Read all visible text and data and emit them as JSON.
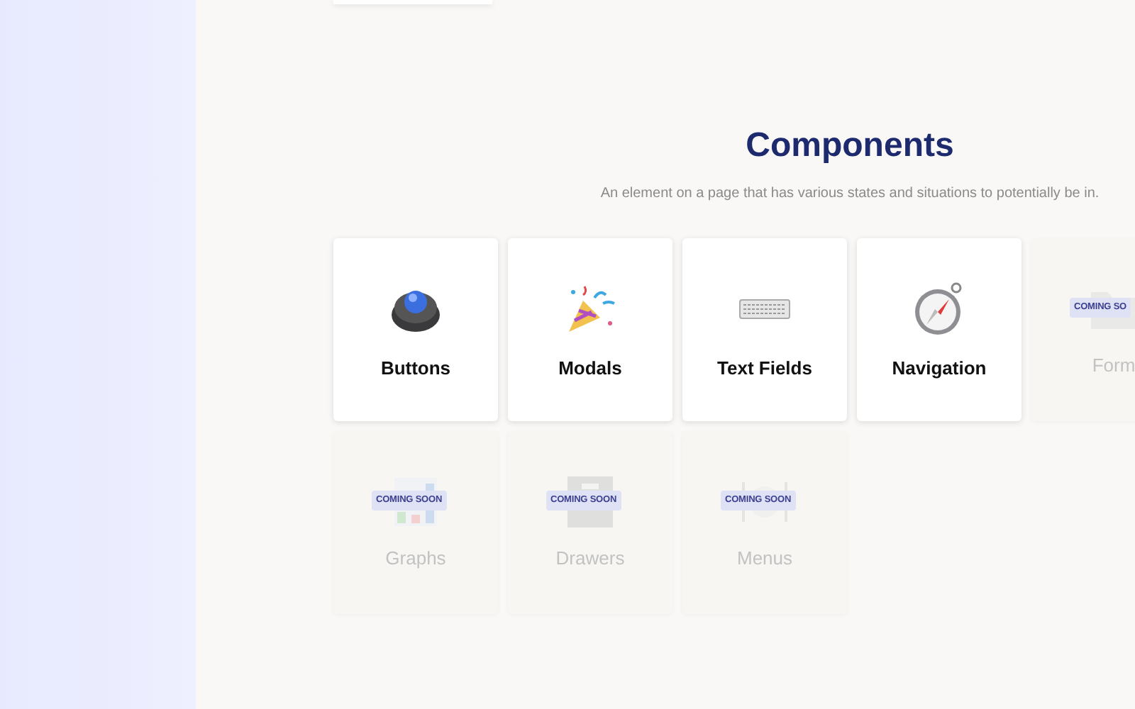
{
  "section": {
    "title": "Components",
    "subtitle": "An element on a page that has various states and situations to potentially be in."
  },
  "cards": [
    {
      "label": "Buttons",
      "kind": "available"
    },
    {
      "label": "Modals",
      "kind": "available"
    },
    {
      "label": "Text Fields",
      "kind": "available"
    },
    {
      "label": "Navigation",
      "kind": "available"
    },
    {
      "label": "Form",
      "kind": "coming_soon",
      "badge": "COMING SO"
    },
    {
      "label": "Graphs",
      "kind": "coming_soon",
      "badge": "COMING SOON"
    },
    {
      "label": "Drawers",
      "kind": "coming_soon",
      "badge": "COMING SOON"
    },
    {
      "label": "Menus",
      "kind": "coming_soon",
      "badge": "COMING SOON"
    }
  ]
}
